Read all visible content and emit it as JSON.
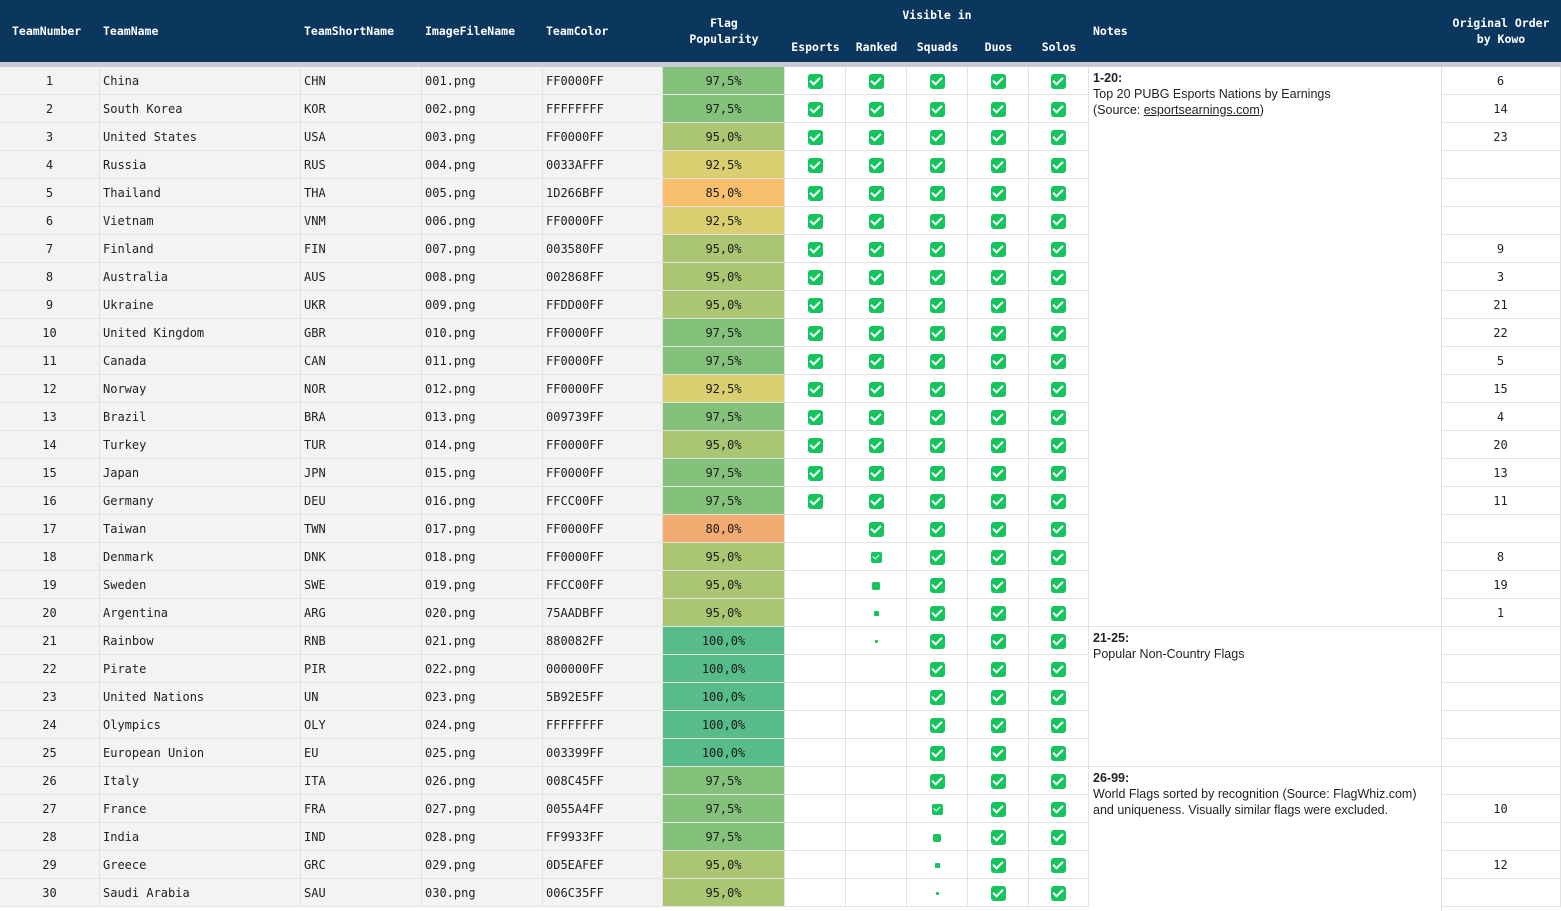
{
  "header": {
    "team_number": "TeamNumber",
    "team_name": "TeamName",
    "team_short_name": "TeamShortName",
    "image_file_name": "ImageFileName",
    "team_color": "TeamColor",
    "flag_popularity_1": "Flag",
    "flag_popularity_2": "Popularity",
    "visible_in": "Visible in",
    "esports": "Esports",
    "ranked": "Ranked",
    "squads": "Squads",
    "duos": "Duos",
    "solos": "Solos",
    "notes": "Notes",
    "original_order_1": "Original Order",
    "original_order_2": "by Kowo"
  },
  "rows": [
    {
      "num": "1",
      "name": "China",
      "short": "CHN",
      "file": "001.png",
      "color": "FF0000FF",
      "pop": "97,5%",
      "popbg": "#84c17b",
      "esports": "full",
      "ranked": "full",
      "orig": "6"
    },
    {
      "num": "2",
      "name": "South Korea",
      "short": "KOR",
      "file": "002.png",
      "color": "FFFFFFFF",
      "pop": "97,5%",
      "popbg": "#84c17b",
      "esports": "full",
      "ranked": "full",
      "orig": "14"
    },
    {
      "num": "3",
      "name": "United States",
      "short": "USA",
      "file": "003.png",
      "color": "FF0000FF",
      "pop": "95,0%",
      "popbg": "#aac673",
      "esports": "full",
      "ranked": "full",
      "orig": "23"
    },
    {
      "num": "4",
      "name": "Russia",
      "short": "RUS",
      "file": "004.png",
      "color": "0033AFFF",
      "pop": "92,5%",
      "popbg": "#d9cf70",
      "esports": "full",
      "ranked": "full",
      "orig": ""
    },
    {
      "num": "5",
      "name": "Thailand",
      "short": "THA",
      "file": "005.png",
      "color": "1D266BFF",
      "pop": "85,0%",
      "popbg": "#f8c06e",
      "esports": "full",
      "ranked": "full",
      "orig": ""
    },
    {
      "num": "6",
      "name": "Vietnam",
      "short": "VNM",
      "file": "006.png",
      "color": "FF0000FF",
      "pop": "92,5%",
      "popbg": "#d9cf70",
      "esports": "full",
      "ranked": "full",
      "orig": ""
    },
    {
      "num": "7",
      "name": "Finland",
      "short": "FIN",
      "file": "007.png",
      "color": "003580FF",
      "pop": "95,0%",
      "popbg": "#aac673",
      "esports": "full",
      "ranked": "full",
      "orig": "9"
    },
    {
      "num": "8",
      "name": "Australia",
      "short": "AUS",
      "file": "008.png",
      "color": "002868FF",
      "pop": "95,0%",
      "popbg": "#aac673",
      "esports": "full",
      "ranked": "full",
      "orig": "3"
    },
    {
      "num": "9",
      "name": "Ukraine",
      "short": "UKR",
      "file": "009.png",
      "color": "FFDD00FF",
      "pop": "95,0%",
      "popbg": "#aac673",
      "esports": "full",
      "ranked": "full",
      "orig": "21"
    },
    {
      "num": "10",
      "name": "United Kingdom",
      "short": "GBR",
      "file": "010.png",
      "color": "FF0000FF",
      "pop": "97,5%",
      "popbg": "#84c17b",
      "esports": "full",
      "ranked": "full",
      "orig": "22"
    },
    {
      "num": "11",
      "name": "Canada",
      "short": "CAN",
      "file": "011.png",
      "color": "FF0000FF",
      "pop": "97,5%",
      "popbg": "#84c17b",
      "esports": "full",
      "ranked": "full",
      "orig": "5"
    },
    {
      "num": "12",
      "name": "Norway",
      "short": "NOR",
      "file": "012.png",
      "color": "FF0000FF",
      "pop": "92,5%",
      "popbg": "#d9cf70",
      "esports": "full",
      "ranked": "full",
      "orig": "15"
    },
    {
      "num": "13",
      "name": "Brazil",
      "short": "BRA",
      "file": "013.png",
      "color": "009739FF",
      "pop": "97,5%",
      "popbg": "#84c17b",
      "esports": "full",
      "ranked": "full",
      "orig": "4"
    },
    {
      "num": "14",
      "name": "Turkey",
      "short": "TUR",
      "file": "014.png",
      "color": "FF0000FF",
      "pop": "95,0%",
      "popbg": "#aac673",
      "esports": "full",
      "ranked": "full",
      "orig": "20"
    },
    {
      "num": "15",
      "name": "Japan",
      "short": "JPN",
      "file": "015.png",
      "color": "FF0000FF",
      "pop": "97,5%",
      "popbg": "#84c17b",
      "esports": "full",
      "ranked": "full",
      "orig": "13"
    },
    {
      "num": "16",
      "name": "Germany",
      "short": "DEU",
      "file": "016.png",
      "color": "FFCC00FF",
      "pop": "97,5%",
      "popbg": "#84c17b",
      "esports": "full",
      "ranked": "full",
      "orig": "11"
    },
    {
      "num": "17",
      "name": "Taiwan",
      "short": "TWN",
      "file": "017.png",
      "color": "FF0000FF",
      "pop": "80,0%",
      "popbg": "#f2ab70",
      "esports": "none",
      "ranked": "full",
      "orig": ""
    },
    {
      "num": "18",
      "name": "Denmark",
      "short": "DNK",
      "file": "018.png",
      "color": "FF0000FF",
      "pop": "95,0%",
      "popbg": "#aac673",
      "esports": "none",
      "ranked": "s11",
      "orig": "8"
    },
    {
      "num": "19",
      "name": "Sweden",
      "short": "SWE",
      "file": "019.png",
      "color": "FFCC00FF",
      "pop": "95,0%",
      "popbg": "#aac673",
      "esports": "none",
      "ranked": "s8",
      "orig": "19"
    },
    {
      "num": "20",
      "name": "Argentina",
      "short": "ARG",
      "file": "020.png",
      "color": "75AADBFF",
      "pop": "95,0%",
      "popbg": "#aac673",
      "esports": "none",
      "ranked": "s5",
      "orig": "1"
    },
    {
      "num": "21",
      "name": "Rainbow",
      "short": "RNB",
      "file": "021.png",
      "color": "880082FF",
      "pop": "100,0%",
      "popbg": "#57bb8a",
      "esports": "none",
      "ranked": "s3",
      "orig": ""
    },
    {
      "num": "22",
      "name": "Pirate",
      "short": "PIR",
      "file": "022.png",
      "color": "000000FF",
      "pop": "100,0%",
      "popbg": "#57bb8a",
      "esports": "none",
      "ranked": "none",
      "orig": ""
    },
    {
      "num": "23",
      "name": "United Nations",
      "short": "UN",
      "file": "023.png",
      "color": "5B92E5FF",
      "pop": "100,0%",
      "popbg": "#57bb8a",
      "esports": "none",
      "ranked": "none",
      "orig": ""
    },
    {
      "num": "24",
      "name": "Olympics",
      "short": "OLY",
      "file": "024.png",
      "color": "FFFFFFFF",
      "pop": "100,0%",
      "popbg": "#57bb8a",
      "esports": "none",
      "ranked": "none",
      "orig": ""
    },
    {
      "num": "25",
      "name": "European Union",
      "short": "EU",
      "file": "025.png",
      "color": "003399FF",
      "pop": "100,0%",
      "popbg": "#57bb8a",
      "esports": "none",
      "ranked": "none",
      "orig": ""
    },
    {
      "num": "26",
      "name": "Italy",
      "short": "ITA",
      "file": "026.png",
      "color": "008C45FF",
      "pop": "97,5%",
      "popbg": "#84c17b",
      "esports": "none",
      "ranked": "none",
      "squads": "full",
      "orig": ""
    },
    {
      "num": "27",
      "name": "France",
      "short": "FRA",
      "file": "027.png",
      "color": "0055A4FF",
      "pop": "97,5%",
      "popbg": "#84c17b",
      "esports": "none",
      "ranked": "none",
      "squads": "s11",
      "orig": "10"
    },
    {
      "num": "28",
      "name": "India",
      "short": "IND",
      "file": "028.png",
      "color": "FF9933FF",
      "pop": "97,5%",
      "popbg": "#84c17b",
      "esports": "none",
      "ranked": "none",
      "squads": "s8",
      "orig": ""
    },
    {
      "num": "29",
      "name": "Greece",
      "short": "GRC",
      "file": "029.png",
      "color": "0D5EAFEF",
      "pop": "95,0%",
      "popbg": "#aac673",
      "esports": "none",
      "ranked": "none",
      "squads": "s5",
      "orig": "12"
    },
    {
      "num": "30",
      "name": "Saudi Arabia",
      "short": "SAU",
      "file": "030.png",
      "color": "006C35FF",
      "pop": "95,0%",
      "popbg": "#aac673",
      "esports": "none",
      "ranked": "none",
      "squads": "s3",
      "orig": ""
    }
  ],
  "notes": {
    "n1_title": "1-20:",
    "n1_line1": "Top 20 PUBG Esports Nations by Earnings",
    "n1_line2_pre": "(Source: ",
    "n1_link": "esportsearnings.com",
    "n1_line2_post": ")",
    "n2_title": "21-25:",
    "n2_line1": "Popular Non-Country Flags",
    "n3_title": "26-99:",
    "n3_line1": "World Flags sorted by recognition (Source: FlagWhiz.com)",
    "n3_line2": "and uniqueness. Visually similar flags were excluded."
  },
  "colors": {
    "header_bg": "#0b375f",
    "checkbox_green": "#14c45c"
  }
}
